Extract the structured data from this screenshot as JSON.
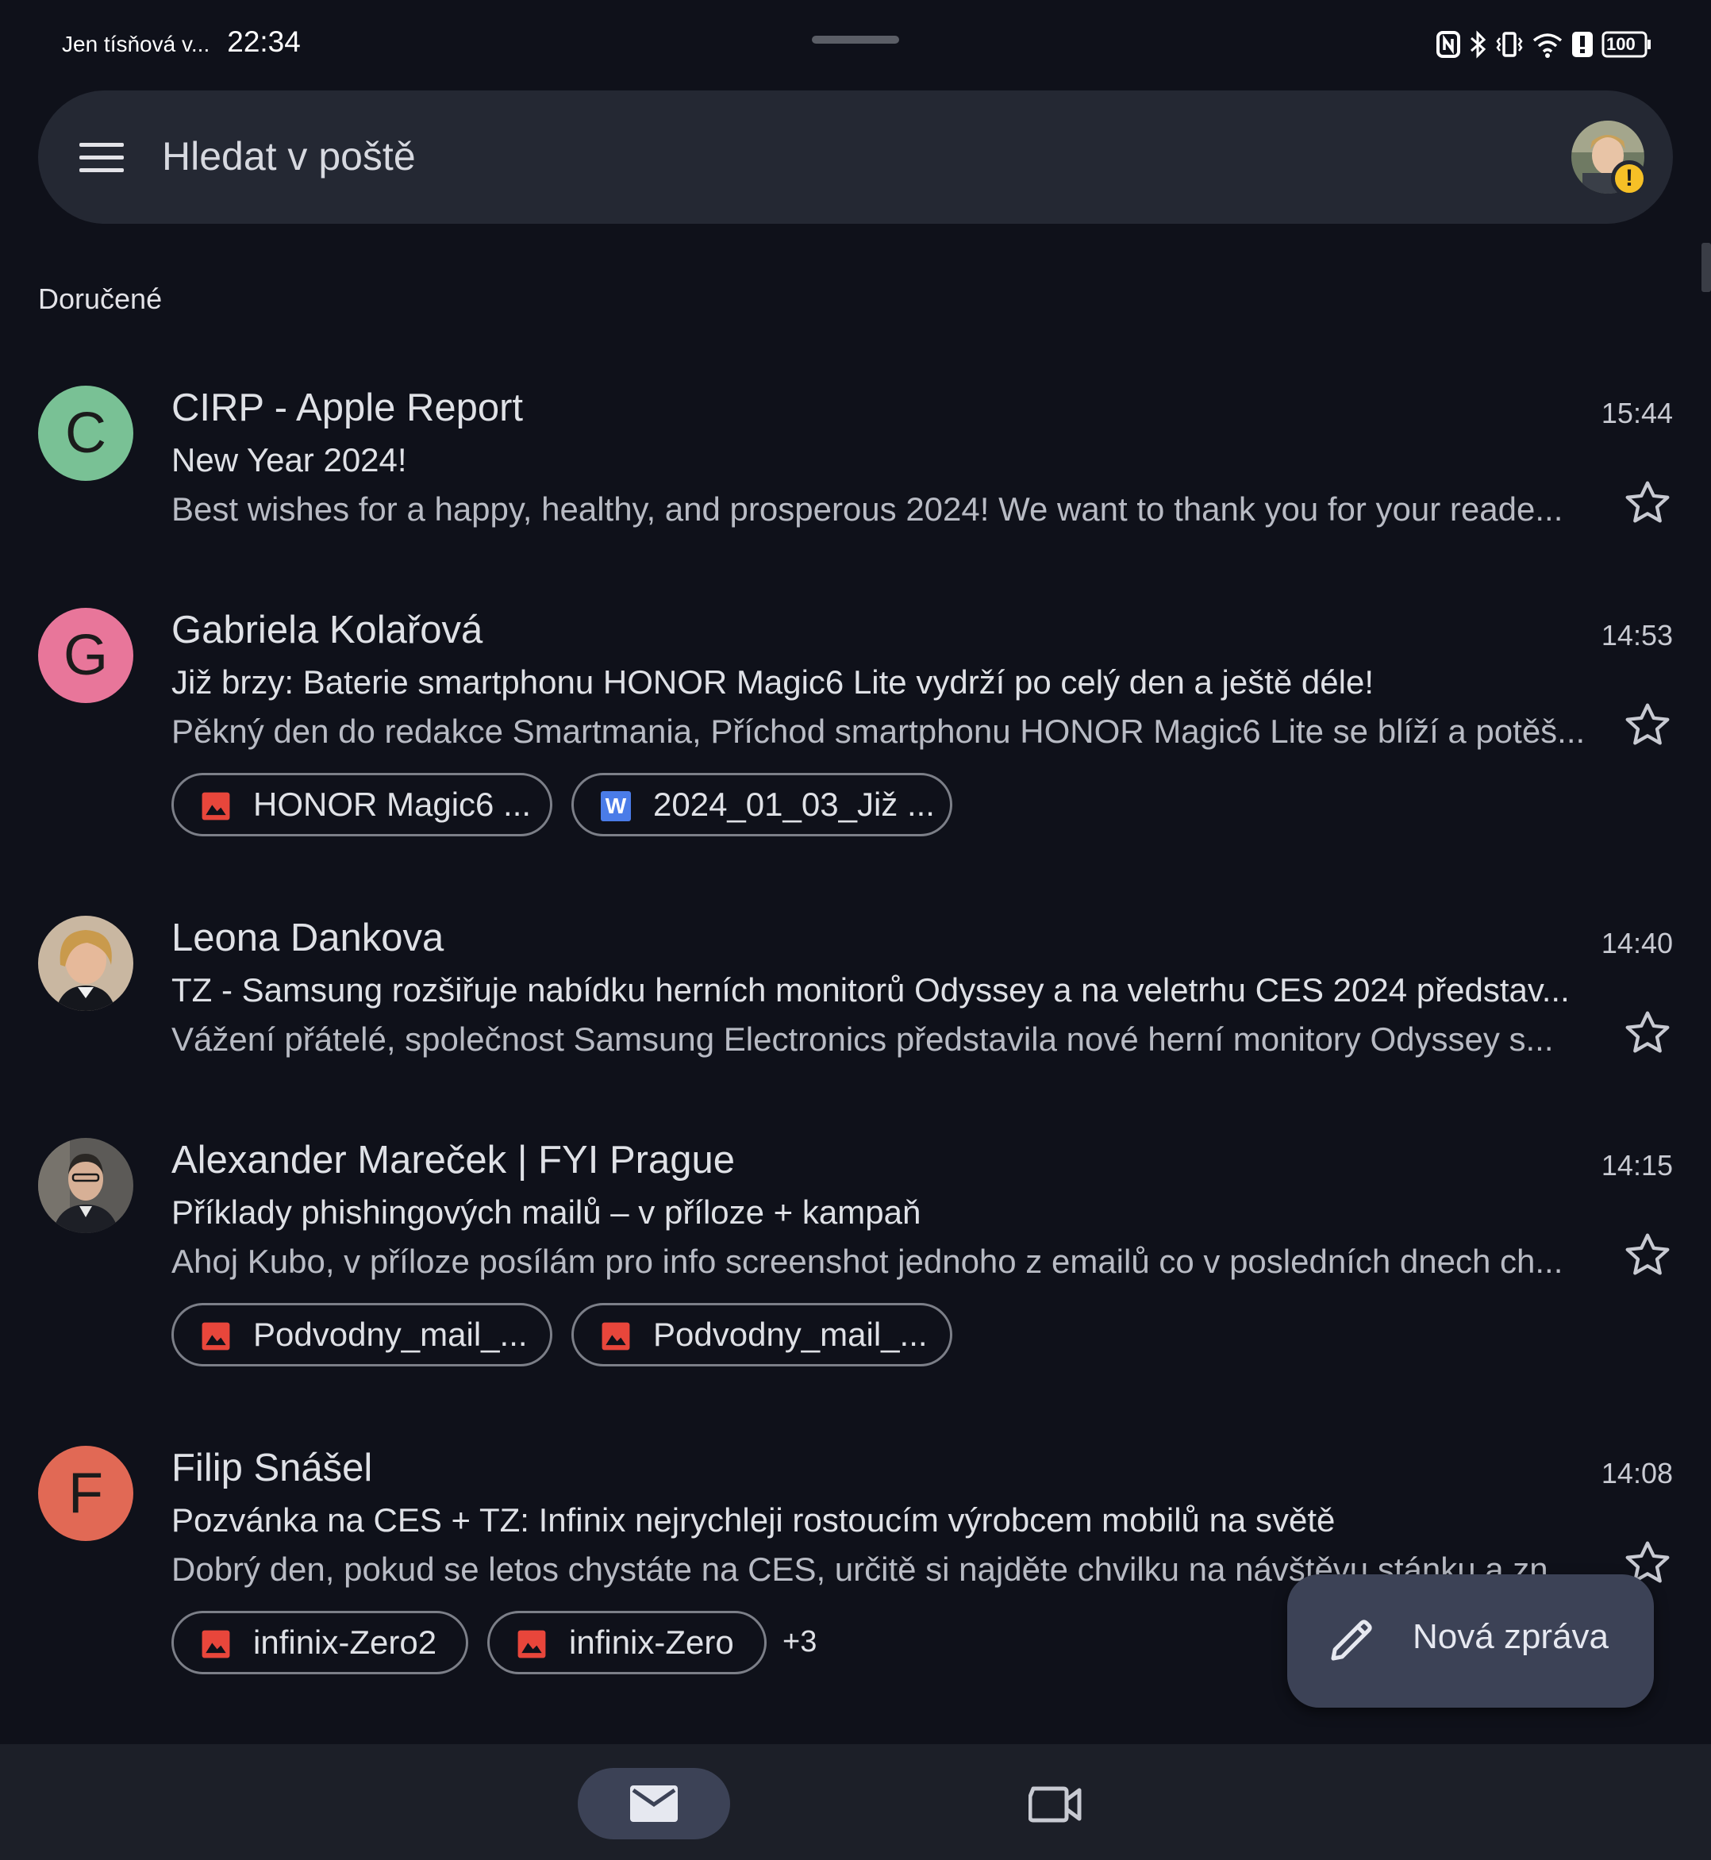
{
  "status_bar": {
    "carrier": "Jen tísňová v...",
    "time": "22:34",
    "battery": "100",
    "icons": [
      "nfc-icon",
      "bluetooth-icon",
      "vibrate-icon",
      "wifi-icon",
      "alert-icon",
      "battery-icon"
    ]
  },
  "search": {
    "placeholder": "Hledat v poště",
    "menu_icon": "hamburger-menu-icon",
    "account_warning": "!"
  },
  "section_label": "Doručené",
  "colors": {
    "background": "#0f111a",
    "search_bg": "#242833",
    "avatar_c": "#79c195",
    "avatar_g": "#e8769a",
    "avatar_f": "#e16955",
    "fab_bg": "#3c4256",
    "image_icon": "#e8463b",
    "word_icon": "#4a7ce8"
  },
  "emails": [
    {
      "sender": "CIRP - Apple Report",
      "initial": "C",
      "time": "15:44",
      "subject": "New Year 2024!",
      "preview": "Best wishes for a happy, healthy, and prosperous 2024! We want to thank you for your reade...",
      "attachments": []
    },
    {
      "sender": "Gabriela Kolařová",
      "initial": "G",
      "time": "14:53",
      "subject": "Již brzy: Baterie smartphonu HONOR Magic6 Lite vydrží po celý den a ještě déle!",
      "preview": "Pěkný den do redakce Smartmania, Příchod smartphonu HONOR Magic6 Lite se blíží a potěš...",
      "attachments": [
        {
          "label": "HONOR Magic6 ...",
          "type": "image"
        },
        {
          "label": "2024_01_03_Již ...",
          "type": "word",
          "glyph": "W"
        }
      ]
    },
    {
      "sender": "Leona Dankova",
      "initial": "",
      "time": "14:40",
      "subject": "TZ - Samsung rozšiřuje nabídku herních monitorů Odyssey a na veletrhu CES 2024 představ...",
      "preview": "Vážení přátelé, společnost Samsung Electronics představila nové herní monitory Odyssey s...",
      "attachments": []
    },
    {
      "sender": "Alexander Mareček | FYI Prague",
      "initial": "",
      "time": "14:15",
      "subject": "Příklady phishingových mailů – v příloze + kampaň",
      "preview": "Ahoj Kubo, v příloze posílám pro info screenshot jednoho z emailů co v posledních dnech ch...",
      "attachments": [
        {
          "label": "Podvodny_mail_...",
          "type": "image"
        },
        {
          "label": "Podvodny_mail_...",
          "type": "image"
        }
      ]
    },
    {
      "sender": "Filip Snášel",
      "initial": "F",
      "time": "14:08",
      "subject": "Pozvánka na CES + TZ: Infinix nejrychleji rostoucím výrobcem mobilů na světě",
      "preview": "Dobrý den, pokud se letos chystáte na CES, určitě si najděte chvilku na návštěvu stánku a zn...",
      "attachments": [
        {
          "label": "infinix-Zero2",
          "type": "image"
        },
        {
          "label": "infinix-Zero",
          "type": "image"
        }
      ],
      "more_attachments": "+3"
    }
  ],
  "fab": {
    "label": "Nová zpráva",
    "icon": "pencil-icon"
  },
  "bottom_nav": {
    "items": [
      {
        "icon": "mail-icon",
        "active": true
      },
      {
        "icon": "video-camera-icon",
        "active": false
      }
    ]
  }
}
